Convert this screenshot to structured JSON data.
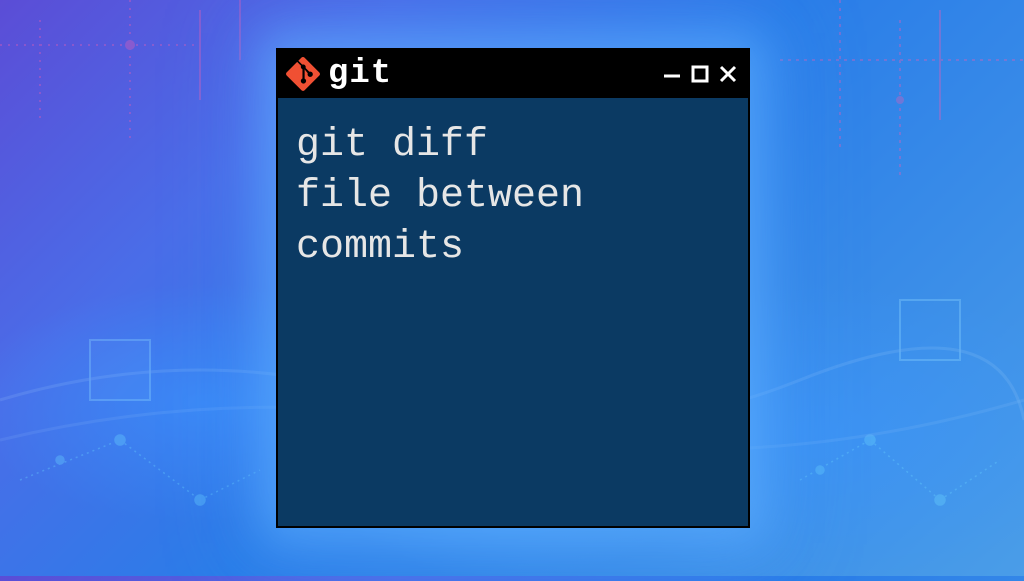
{
  "window": {
    "title": "git",
    "body_text": "git diff\nfile between\ncommits"
  },
  "icons": {
    "git_logo": "git-logo",
    "minimize": "minimize",
    "maximize": "maximize",
    "close": "close"
  },
  "colors": {
    "terminal_bg": "#0b3a63",
    "titlebar_bg": "#000000",
    "text": "#e6e6e6",
    "git_orange": "#f05033"
  }
}
